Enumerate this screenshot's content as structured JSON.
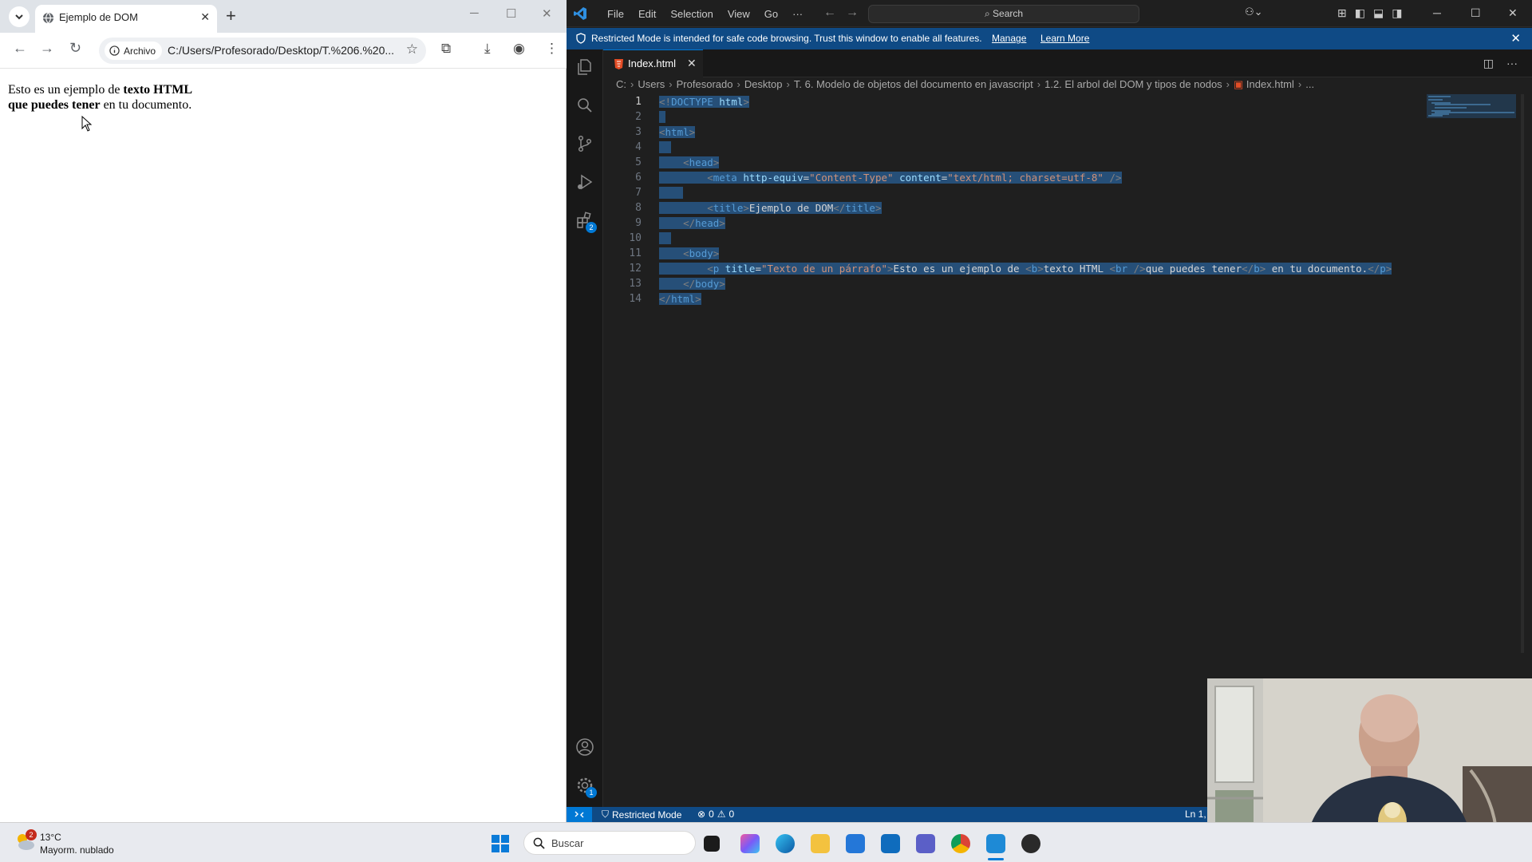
{
  "browser": {
    "tab_title": "Ejemplo de DOM",
    "site_chip": "Archivo",
    "url": "C:/Users/Profesorado/Desktop/T.%206.%20...",
    "page": {
      "line1_start": "Esto es un ejemplo de ",
      "line1_bold": "texto HTML",
      "line2_bold": "que puedes tener",
      "line2_end": " en tu documento."
    }
  },
  "vscode": {
    "menu": [
      "File",
      "Edit",
      "Selection",
      "View",
      "Go",
      "···"
    ],
    "search_placeholder": "Search",
    "banner": {
      "message": "Restricted Mode is intended for safe code browsing. Trust this window to enable all features.",
      "manage": "Manage",
      "learn_more": "Learn More"
    },
    "tab": "Index.html",
    "breadcrumb": [
      "C:",
      "Users",
      "Profesorado",
      "Desktop",
      "T. 6. Modelo de objetos del documento en javascript",
      "1.2. El arbol del DOM y tipos de nodos",
      "Index.html",
      "..."
    ],
    "line_numbers": [
      "1",
      "2",
      "3",
      "4",
      "5",
      "6",
      "7",
      "8",
      "9",
      "10",
      "11",
      "12",
      "13",
      "14"
    ],
    "extensions_badge": "2",
    "settings_badge": "1",
    "status": {
      "restricted": "Restricted Mode",
      "errors": "0",
      "warnings": "0",
      "position": "Ln 1,"
    }
  },
  "taskbar": {
    "weather_temp": "13°C",
    "weather_desc": "Mayorm. nublado",
    "weather_badge": "2",
    "search_placeholder": "Buscar"
  }
}
